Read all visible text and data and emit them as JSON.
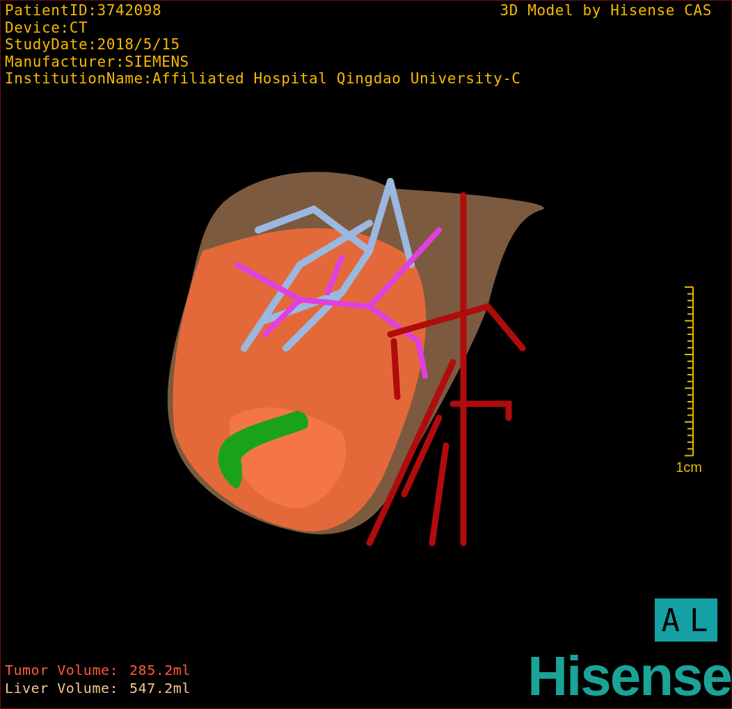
{
  "patient_info": [
    "PatientID:3742098",
    "Device:CT",
    "StudyDate:2018/5/15",
    "Manufacturer:SIEMENS",
    "InstitutionName:Affiliated Hospital Qingdao University-C"
  ],
  "credit": "3D Model by Hisense CAS",
  "volumes": [
    {
      "label": "Tumor Volume:",
      "value": "285.2ml",
      "color": "#ff5a3c"
    },
    {
      "label": "Liver Volume:",
      "value": "547.2ml",
      "color": "#f2c58e"
    }
  ],
  "scale_bar": {
    "label": "1cm"
  },
  "orientation": "AL",
  "logo": "Hisense"
}
